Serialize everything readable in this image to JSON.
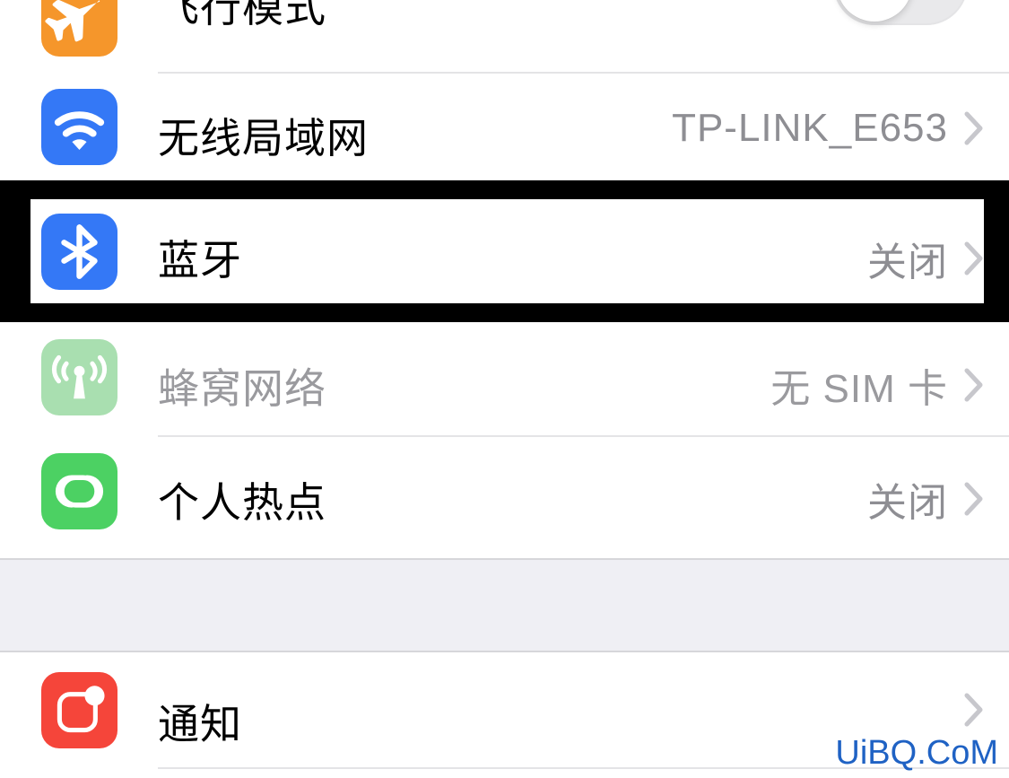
{
  "screen": {
    "background": "#ffffff",
    "section_gap_color": "#efeff4",
    "separator_color": "#e4e4e6",
    "value_text_color": "#8e8e93",
    "chevron_color": "#c7c7cc",
    "highlight_color": "#000000"
  },
  "rows": [
    {
      "id": "airplane-mode",
      "label": "飞行模式",
      "icon": "airplane-icon",
      "icon_color": "#f5962b",
      "accessory": "toggle",
      "toggle_on": false,
      "value": "",
      "disabled": false
    },
    {
      "id": "wifi",
      "label": "无线局域网",
      "icon": "wifi-icon",
      "icon_color": "#3478f6",
      "accessory": "chevron",
      "value": "TP-LINK_E653",
      "disabled": false
    },
    {
      "id": "bluetooth",
      "label": "蓝牙",
      "icon": "bluetooth-icon",
      "icon_color": "#3478f6",
      "accessory": "chevron",
      "value": "关闭",
      "disabled": false,
      "highlighted": true
    },
    {
      "id": "cellular",
      "label": "蜂窝网络",
      "icon": "cellular-antenna-icon",
      "icon_color": "#a9dfb0",
      "accessory": "chevron",
      "value": "无 SIM 卡",
      "disabled": true
    },
    {
      "id": "personal-hotspot",
      "label": "个人热点",
      "icon": "hotspot-link-icon",
      "icon_color": "#4cd163",
      "accessory": "chevron",
      "value": "关闭",
      "disabled": false
    },
    {
      "id": "notifications",
      "label": "通知",
      "icon": "notifications-badge-icon",
      "icon_color": "#f5453a",
      "accessory": "chevron",
      "value": "",
      "disabled": false
    }
  ],
  "watermark": {
    "text": "UiBQ.CoM",
    "color": "#1f62c4"
  }
}
